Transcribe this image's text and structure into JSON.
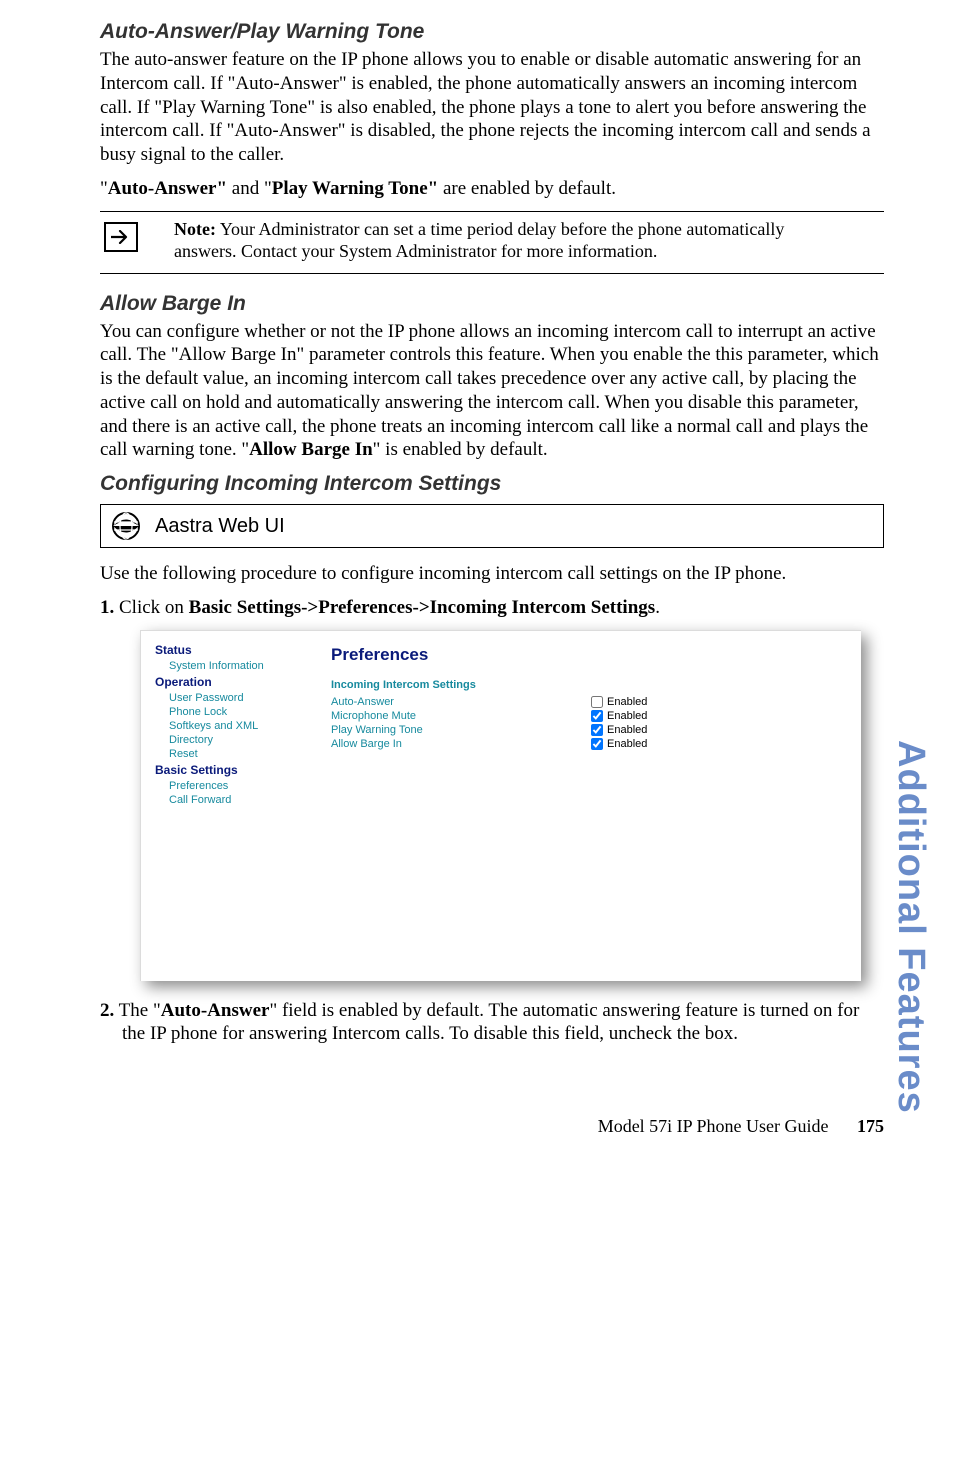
{
  "sections": {
    "autoAnswer": {
      "title": "Auto-Answer/Play Warning Tone",
      "para": "The auto-answer feature on the IP phone allows you to enable or disable automatic answering for an Intercom call. If \"Auto-Answer\" is enabled, the phone automatically answers an incoming intercom call. If \"Play Warning Tone\" is also enabled, the phone plays a tone to alert you before answering the intercom call. If \"Auto-Answer\" is disabled, the phone rejects the incoming intercom call and sends a busy signal to the caller.",
      "defaults_prefix": "\"",
      "defaults_b1": "Auto-Answer\"",
      "defaults_mid": " and \"",
      "defaults_b2": "Play Warning Tone\"",
      "defaults_suffix": " are enabled by default."
    },
    "note": {
      "label": "Note:",
      "text": " Your Administrator can set a time period delay before the phone automatically answers. Contact your System Administrator for more information."
    },
    "allowBarge": {
      "title": "Allow Barge In",
      "para_a": "You can configure whether or not the IP phone allows an incoming intercom call to interrupt an active call. The \"Allow Barge In\" parameter controls this feature. When you enable the this parameter, which is the default value, an incoming intercom call takes precedence over any active call, by placing the active call on hold and automatically answering the intercom call. When you disable this parameter, and there is an active call, the phone treats an incoming intercom call like a normal call and plays the call warning tone. \"",
      "para_bold": "Allow Barge In",
      "para_b": "\" is enabled by default."
    },
    "configuring": {
      "title": "Configuring Incoming Intercom Settings",
      "webui": "Aastra Web UI",
      "intro": "Use the following procedure to configure incoming intercom call settings on the IP phone."
    },
    "steps": {
      "s1_num": "1.",
      "s1_a": "Click on ",
      "s1_bold": "Basic Settings->Preferences->Incoming Intercom Settings",
      "s1_b": ".",
      "s2_num": "2.",
      "s2_a": "The \"",
      "s2_bold": "Auto-Answer",
      "s2_b": "\" field is enabled by default. The automatic answering feature is turned on for the IP phone for answering Intercom calls. To disable this field, uncheck the box."
    }
  },
  "screenshot": {
    "nav": {
      "status": "Status",
      "sysinfo": "System Information",
      "operation": "Operation",
      "items_op": [
        "User Password",
        "Phone Lock",
        "Softkeys and XML",
        "Directory",
        "Reset"
      ],
      "basic": "Basic Settings",
      "items_bs": [
        "Preferences",
        "Call Forward"
      ]
    },
    "main": {
      "title": "Preferences",
      "subtitle": "Incoming Intercom Settings",
      "rows": [
        {
          "label": "Auto-Answer",
          "checked": false,
          "text": "Enabled"
        },
        {
          "label": "Microphone Mute",
          "checked": true,
          "text": "Enabled"
        },
        {
          "label": "Play Warning Tone",
          "checked": true,
          "text": "Enabled"
        },
        {
          "label": "Allow Barge In",
          "checked": true,
          "text": "Enabled"
        }
      ]
    }
  },
  "sideTab": "Additional Features",
  "footer": {
    "text": "Model 57i IP Phone User Guide",
    "page": "175"
  }
}
